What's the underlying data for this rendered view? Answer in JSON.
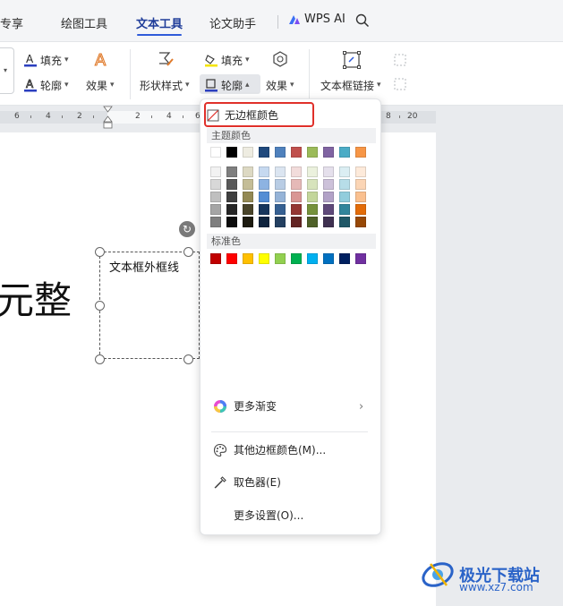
{
  "tabs": [
    {
      "label": "专享"
    },
    {
      "label": "绘图工具"
    },
    {
      "label": "文本工具"
    },
    {
      "label": "论文助手"
    }
  ],
  "active_tab": "文本工具",
  "wps_ai_label": "WPS AI",
  "ribbon": {
    "fill_label": "填充",
    "outline_label": "轮廓",
    "effect_label": "效果",
    "shape_style_label": "形状样式",
    "shape_fill_label": "填充",
    "shape_outline_label": "轮廓",
    "shape_effect_label": "效果",
    "textbox_link_label": "文本框链接"
  },
  "ruler_numbers": [
    "6",
    "4",
    "2",
    "2",
    "4",
    "6",
    "8",
    "20"
  ],
  "document": {
    "big_text": "元整",
    "textbox_text": "文本框外框线"
  },
  "menu": {
    "no_border_label": "无边框颜色",
    "theme_colors_label": "主题颜色",
    "standard_colors_label": "标准色",
    "more_gradient_label": "更多渐变",
    "other_border_color_label": "其他边框颜色(M)...",
    "eyedropper_label": "取色器(E)",
    "more_settings_label": "更多设置(O)...",
    "theme_top_row": [
      "#ffffff",
      "#000000",
      "#eeece1",
      "#1f497d",
      "#4f81bd",
      "#c0504d",
      "#9bbb59",
      "#8064a2",
      "#4bacc6",
      "#f79646"
    ],
    "theme_shades": [
      [
        "#f2f2f2",
        "#7f7f7f",
        "#ddd9c3",
        "#c6d9f0",
        "#dbe5f1",
        "#f2dcdb",
        "#ebf1dd",
        "#e5e0ec",
        "#dbeef3",
        "#fdeada"
      ],
      [
        "#d8d8d8",
        "#595959",
        "#c4bd97",
        "#8db3e2",
        "#b8cce4",
        "#e5b9b7",
        "#d7e3bc",
        "#ccc1d9",
        "#b7dde8",
        "#fbd5b5"
      ],
      [
        "#bfbfbf",
        "#3f3f3f",
        "#938953",
        "#548dd4",
        "#95b3d7",
        "#d99694",
        "#c3d69b",
        "#b2a2c7",
        "#92cddc",
        "#fac08f"
      ],
      [
        "#a5a5a5",
        "#262626",
        "#494429",
        "#17365d",
        "#366092",
        "#953734",
        "#76923c",
        "#5f497a",
        "#31859b",
        "#e36c09"
      ],
      [
        "#7f7f7f",
        "#0c0c0c",
        "#1d1b10",
        "#0f243e",
        "#244061",
        "#632423",
        "#4f6128",
        "#3f3151",
        "#205867",
        "#974806"
      ]
    ],
    "standard_colors": [
      "#c00000",
      "#ff0000",
      "#ffc000",
      "#ffff00",
      "#92d050",
      "#00b050",
      "#00b0f0",
      "#0070c0",
      "#002060",
      "#7030a0"
    ]
  },
  "watermark": {
    "title": "极光下载站",
    "url": "www.xz7.com"
  }
}
